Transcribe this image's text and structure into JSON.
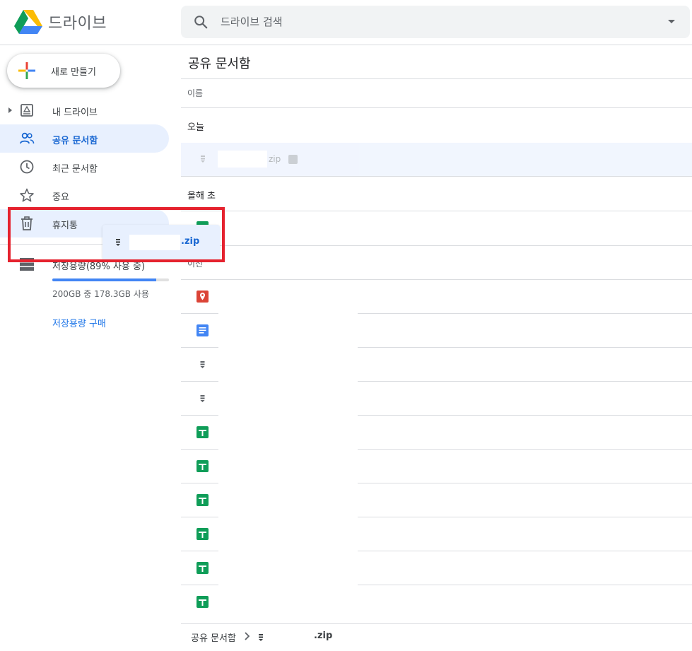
{
  "app": {
    "title": "드라이브"
  },
  "search": {
    "placeholder": "드라이브 검색"
  },
  "new_button": {
    "label": "새로 만들기"
  },
  "sidebar": {
    "items": [
      {
        "label": "내 드라이브",
        "icon": "drive-folder-icon",
        "expandable": true
      },
      {
        "label": "공유 문서함",
        "icon": "shared-people-icon",
        "active": true
      },
      {
        "label": "최근 문서함",
        "icon": "clock-icon"
      },
      {
        "label": "중요",
        "icon": "star-icon"
      },
      {
        "label": "휴지통",
        "icon": "trash-icon",
        "hovered": true
      }
    ],
    "storage": {
      "label": "저장용량(89% 사용 중)",
      "percent_used": 89,
      "detail": "200GB 중 178.3GB 사용",
      "buy_link": "저장용량 구매"
    }
  },
  "main": {
    "title": "공유 문서함",
    "column_header": "이름",
    "groups": [
      "오늘",
      "올해 초",
      "이전"
    ],
    "selected_file": {
      "name": "zip"
    },
    "file_icons": [
      "sheets-icon",
      "maps-icon",
      "docs-icon",
      "zip-icon",
      "zip-icon",
      "sheets-icon",
      "sheets-icon",
      "sheets-icon",
      "sheets-icon",
      "sheets-icon",
      "sheets-icon"
    ]
  },
  "drag_ghost": {
    "label": ".zip"
  },
  "breadcrumb": {
    "root": "공유 문서함",
    "file": ".zip"
  },
  "colors": {
    "accent": "#1a73e8",
    "active_bg": "#e8f0fe",
    "highlight": "#e5222e",
    "sheets": "#0f9d58",
    "maps": "#db4437",
    "docs": "#4285f4"
  }
}
